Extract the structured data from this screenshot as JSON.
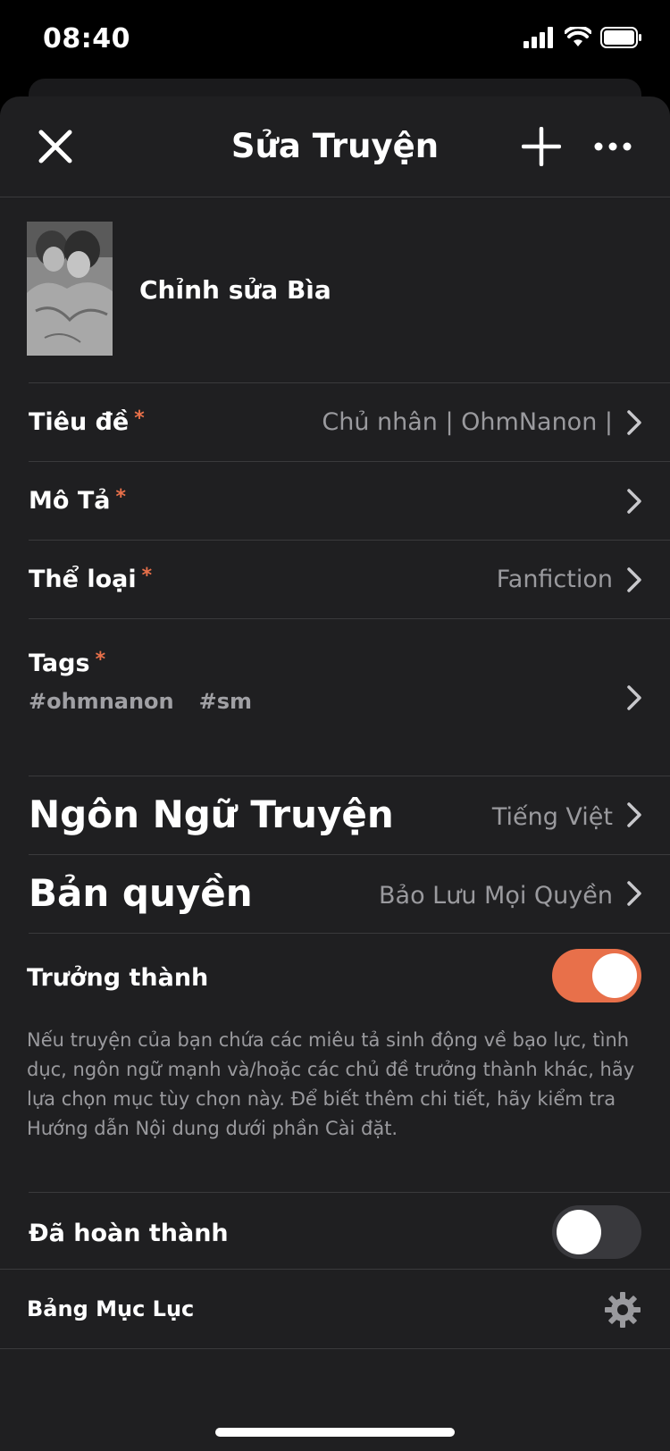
{
  "status": {
    "time": "08:40"
  },
  "nav": {
    "title": "Sửa Truyện"
  },
  "cover": {
    "label": "Chỉnh sửa Bìa"
  },
  "rows": {
    "title": {
      "label": "Tiêu đề",
      "required": "*",
      "value": "Chủ nhân | OhmNanon |"
    },
    "description": {
      "label": "Mô Tả",
      "required": "*"
    },
    "genre": {
      "label": "Thể loại",
      "required": "*",
      "value": "Fanfiction"
    },
    "tags": {
      "label": "Tags",
      "required": "*",
      "items": [
        "#ohmnanon",
        "#sm"
      ]
    },
    "language": {
      "label": "Ngôn Ngữ Truyện",
      "value": "Tiếng Việt"
    },
    "copyright": {
      "label": "Bản quyền",
      "value": "Bảo Lưu Mọi Quyền"
    }
  },
  "mature": {
    "label": "Trưởng thành",
    "enabled": true,
    "description": "Nếu truyện của bạn chứa các miêu tả sinh động về bạo lực, tình dục, ngôn ngữ mạnh và/hoặc các chủ đề trưởng thành khác, hãy lựa chọn mục tùy chọn này. Để biết thêm chi tiết, hãy kiểm tra Hướng dẫn Nội dung dưới phần Cài đặt."
  },
  "completed": {
    "label": "Đã hoàn thành",
    "enabled": false
  },
  "toc": {
    "label": "Bảng Mục Lục"
  },
  "colors": {
    "accent": "#e8704a",
    "background": "#1f1f21"
  }
}
